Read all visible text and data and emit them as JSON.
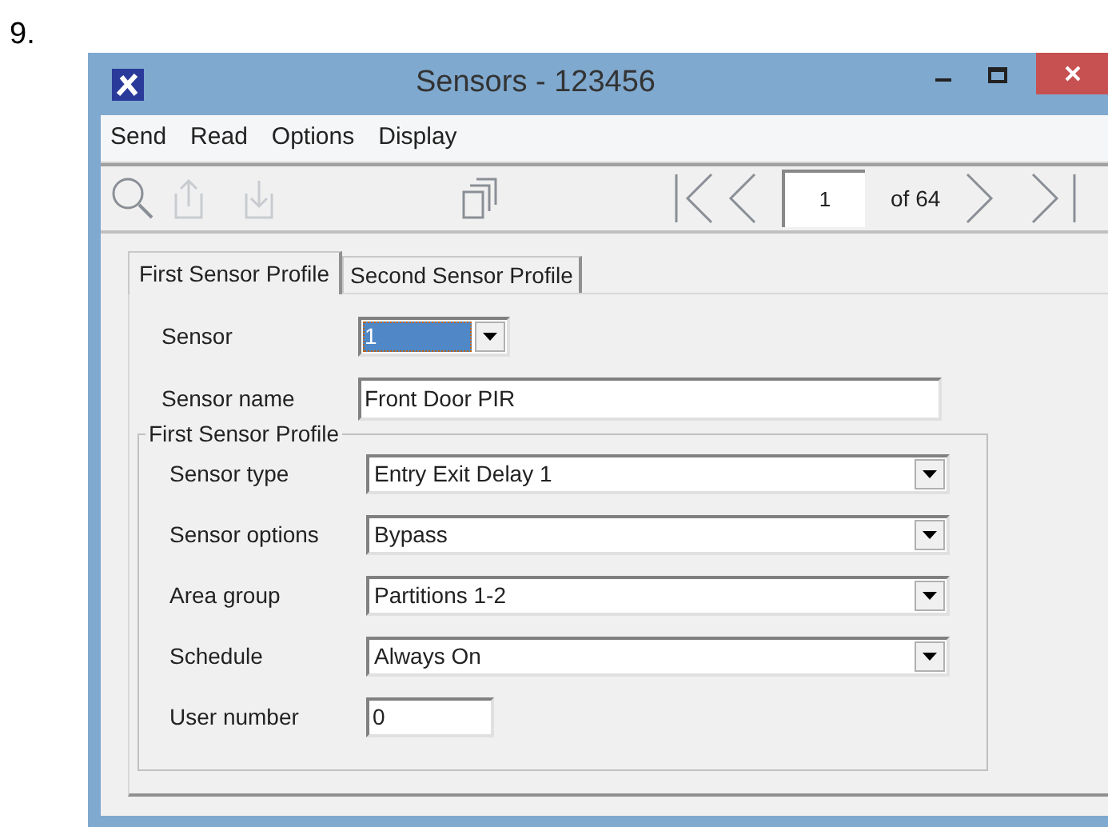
{
  "step_number": "9.",
  "window": {
    "title": "Sensors - 123456"
  },
  "menu": [
    "Send",
    "Read",
    "Options",
    "Display"
  ],
  "pager": {
    "page": "1",
    "of": "of 64"
  },
  "tabs": [
    {
      "label": "First Sensor Profile",
      "selected": true
    },
    {
      "label": "Second Sensor Profile",
      "selected": false
    }
  ],
  "sensor": {
    "label": "Sensor",
    "value": "1"
  },
  "sensor_name": {
    "label": "Sensor name",
    "value": "Front Door PIR"
  },
  "group": {
    "title": "First Sensor Profile",
    "fields": [
      {
        "kind": "dropdown",
        "label": "Sensor type",
        "value": "Entry Exit Delay 1"
      },
      {
        "kind": "dropdown",
        "label": "Sensor options",
        "value": "Bypass"
      },
      {
        "kind": "dropdown",
        "label": "Area group",
        "value": "Partitions 1-2"
      },
      {
        "kind": "dropdown",
        "label": "Schedule",
        "value": "Always On"
      },
      {
        "kind": "text",
        "label": "User number",
        "value": "0"
      }
    ]
  }
}
